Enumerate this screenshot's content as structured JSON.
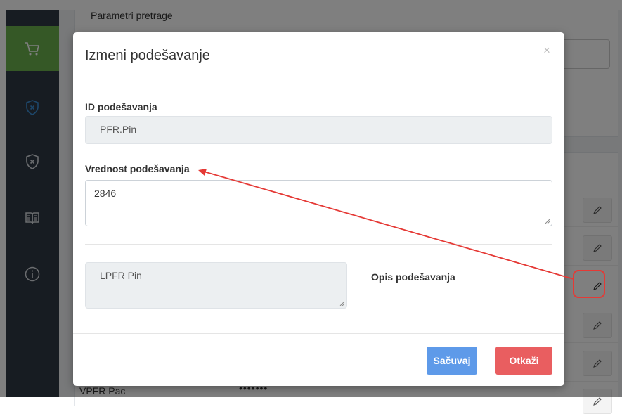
{
  "page": {
    "background_card_title": "Parametri pretrage",
    "background_row_label": "VPFR Pac",
    "background_row_value": "•••••••"
  },
  "sidebar": {
    "items": [
      {
        "icon": "cart-icon",
        "active": true
      },
      {
        "icon": "shield-x-icon",
        "active": false
      },
      {
        "icon": "shield-x-outline-icon",
        "active": false
      },
      {
        "icon": "book-icon",
        "active": false
      },
      {
        "icon": "info-icon",
        "active": false
      }
    ]
  },
  "modal": {
    "title": "Izmeni podešavanje",
    "close_symbol": "×",
    "id_label": "ID podešavanja",
    "id_value": "PFR.Pin",
    "value_label": "Vrednost podešavanja",
    "value_value": "2846",
    "description_value": "LPFR Pin",
    "description_label": "Opis podešavanja",
    "save_label": "Sačuvaj",
    "cancel_label": "Otkaži"
  },
  "colors": {
    "sidebar_bg": "#2f3944",
    "sidebar_active": "#6ab04c",
    "save_button": "#5e9ae9",
    "cancel_button": "#e95e60",
    "annotation": "#e53935"
  }
}
